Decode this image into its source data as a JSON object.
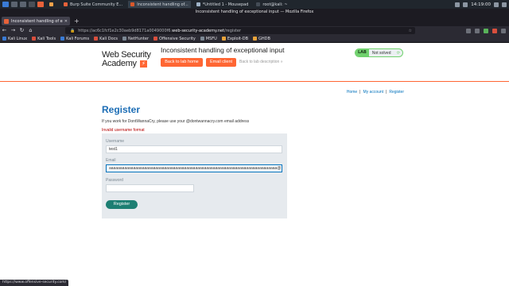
{
  "taskbar": {
    "windows": [
      {
        "label": "",
        "color": "#f4a24a"
      },
      {
        "label": "Burp Suite Community E...",
        "color": "#e8623a"
      },
      {
        "label": "Inconsistent handling of...",
        "color": "#d9582b"
      },
      {
        "label": "*Untitled 1 - Mousepad",
        "color": "#9fb3c8"
      },
      {
        "label": "root@kali: ~",
        "color": "#444c56"
      }
    ],
    "clock": "14:19:00"
  },
  "browser": {
    "window_title": "Inconsistent handling of exceptional input — Mozilla Firefox",
    "tab_label": "Inconsistent handling of e",
    "tab_close": "✕",
    "new_tab": "+",
    "url_prefix": "https://ac6c1fcf1e2c30aeb9d8171a0049000f6.",
    "url_host": "web-security-academy.net",
    "url_path": "/register",
    "bookmarks": [
      "Kali Linux",
      "Kali Tools",
      "Kali Forums",
      "Kali Docs",
      "NetHunter",
      "Offensive Security",
      "MSFU",
      "Exploit-DB",
      "GHDB"
    ],
    "status_url": "https://www.offensive-security.com/"
  },
  "header": {
    "logo_line1": "Web Security",
    "logo_line2": "Academy",
    "logo_mark": "⚡",
    "lab_title": "Inconsistent handling of exceptional input",
    "back_to_lab_home": "Back to lab home",
    "email_client": "Email client",
    "back_to_lab_description": "Back to lab description »",
    "status_badge": "LAB",
    "status_text": "Not solved",
    "status_icon": "⟳"
  },
  "top_nav": {
    "home": "Home",
    "sep": "|",
    "my_account": "My account",
    "register": "Register"
  },
  "register": {
    "title": "Register",
    "info": "If you work for DontWannaCry, please use your @dontwannacry.com email address",
    "error": "Invalid username format",
    "username_label": "Username",
    "username_value": "test1",
    "email_label": "Email",
    "email_value": "aaaaaaaaaaaaaaaaaaaaaaaaaaaaaaaaaaaaaaaaaaaaaaaaaaaaaaaaaaaaaaaaaaaaaaaaaaaa@",
    "password_label": "Password",
    "password_value": "",
    "submit_label": "Register"
  },
  "colors": {
    "accent_orange": "#ff6633",
    "register_button": "#1d7f73",
    "link_blue": "#0071bc",
    "error_red": "#b50000",
    "lab_green": "#70d16d"
  }
}
